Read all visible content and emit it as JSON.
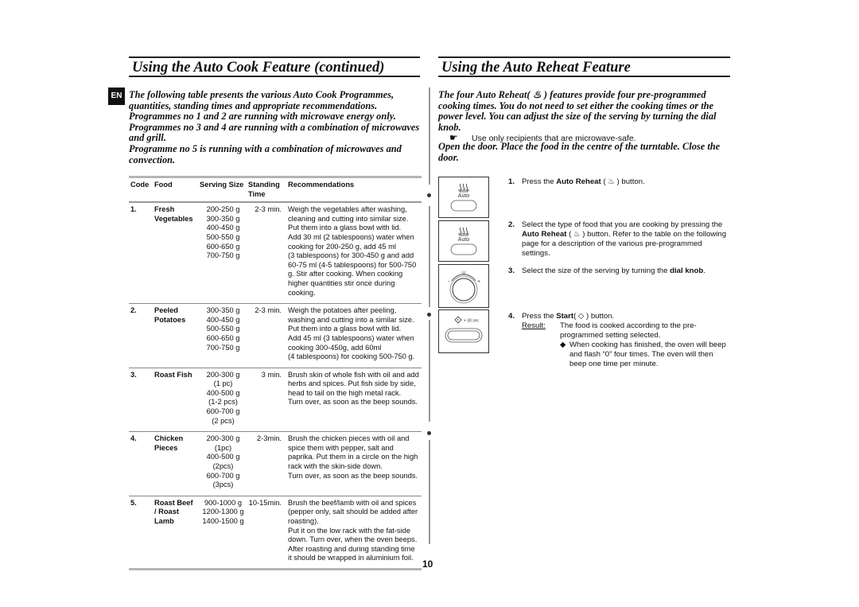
{
  "left": {
    "heading": "Using the Auto Cook Feature (continued)",
    "lang_badge": "EN",
    "intro": [
      "The following table presents the various Auto Cook Programmes, quantities, standing times and appropriate recommendations.",
      "Programmes no 1 and 2 are running with microwave energy only.",
      "Programmes no 3 and 4 are running with a combination of microwaves and grill.",
      "Programme no 5 is running with a combination of microwaves and convection."
    ],
    "table": {
      "headers": [
        "Code",
        "Food",
        "Serving Size",
        "Standing Time",
        "Recommendations"
      ],
      "rows": [
        {
          "code": "1.",
          "food": [
            "Fresh",
            "Vegetables"
          ],
          "sizes": [
            "200-250 g",
            "300-350 g",
            "400-450 g",
            "500-550 g",
            "600-650 g",
            "700-750 g"
          ],
          "time": "2-3 min.",
          "rec": [
            "Weigh the vegetables after washing,",
            "cleaning and cutting into similar size.",
            "Put them into a glass bowl with lid.",
            "Add 30 ml (2 tablespoons) water when",
            "cooking for 200-250 g, add 45 ml",
            "(3 tablespoons) for 300-450 g and add",
            "60-75 ml (4-5 tablespoons) for 500-750",
            "g. Stir after cooking. When cooking",
            "higher quantities stir once during",
            "cooking."
          ]
        },
        {
          "code": "2.",
          "food": [
            "Peeled",
            "Potatoes"
          ],
          "sizes": [
            "300-350 g",
            "400-450 g",
            "500-550 g",
            "600-650 g",
            "700-750 g"
          ],
          "time": "2-3 min.",
          "rec": [
            "Weigh the potatoes after peeling,",
            "washing and cutting into a similar size.",
            "Put them into a glass bowl with lid.",
            "Add 45 ml (3 tablespoons) water when",
            "cooking 300-450g, add 60ml",
            "(4 tablespoons) for cooking 500-750 g."
          ]
        },
        {
          "code": "3.",
          "food": [
            "Roast Fish"
          ],
          "sizes": [
            "200-300 g",
            "(1 pc)",
            "400-500 g",
            "(1-2 pcs)",
            "600-700 g",
            "(2 pcs)"
          ],
          "time": "3 min.",
          "rec": [
            "Brush skin of whole fish with oil and add",
            "herbs and spices. Put fish side by side,",
            "head to tail on the high metal rack.",
            "Turn over, as soon as the beep sounds."
          ]
        },
        {
          "code": "4.",
          "food": [
            "Chicken",
            "Pieces"
          ],
          "sizes": [
            "200-300 g",
            "(1pc)",
            "400-500 g",
            "(2pcs)",
            "600-700 g",
            "(3pcs)"
          ],
          "time": "2-3min.",
          "rec": [
            "Brush the chicken pieces with oil and",
            "spice them with pepper, salt and",
            "paprika. Put them in a circle on the high",
            "rack with the skin-side down.",
            "Turn over, as soon as the beep sounds."
          ]
        },
        {
          "code": "5.",
          "food": [
            "Roast Beef",
            "/ Roast",
            "Lamb"
          ],
          "sizes": [
            "900-1000 g",
            "1200-1300 g",
            "1400-1500 g"
          ],
          "time": "10-15min.",
          "rec": [
            "Brush the beef/lamb with oil and spices",
            "(pepper only, salt should be added after",
            "roasting).",
            "Put it on the low rack with the fat-side",
            "down. Turn over, when the oven beeps.",
            "After roasting and during standing time",
            "it should be wrapped in aluminium foil."
          ]
        }
      ]
    }
  },
  "right": {
    "heading": "Using the Auto Reheat Feature",
    "intro": "The four Auto Reheat( ♨ ) features provide four pre-programmed cooking times. You do not need to set either the cooking times or the power level. You can adjust the size of the serving by turning the dial knob.",
    "note_icon": "pointing-hand-icon",
    "note": "Use only recipients that are microwave-safe.",
    "open_door": "Open the door. Place the food in the centre of the turntable. Close the door.",
    "panel_auto_label": "Auto",
    "panel_start_label": "+ 30 sec",
    "steps": [
      {
        "num": "1.",
        "pre": "Press the ",
        "bold": "Auto Reheat",
        "post": " ( ♨ ) button."
      },
      {
        "num": "2.",
        "pre": "Select the type of food that you are cooking by pressing the ",
        "bold": "Auto Reheat",
        "post": " ( ♨ ) button. Refer to the table on the following page for a description of the various pre-programmed settings."
      },
      {
        "num": "3.",
        "pre": "Select the size of the serving by turning the ",
        "bold": "dial knob",
        "post": "."
      },
      {
        "num": "4.",
        "pre": "Press the ",
        "bold": "Start",
        "post": "( ◇ ) button.",
        "result_label": "Result:",
        "result_text": "The food is cooked according to the pre-programmed setting selected.",
        "bullet": "When cooking has finished, the oven will beep and flash “0” four times. The oven will then beep one time per minute."
      }
    ]
  },
  "page_number": "10"
}
